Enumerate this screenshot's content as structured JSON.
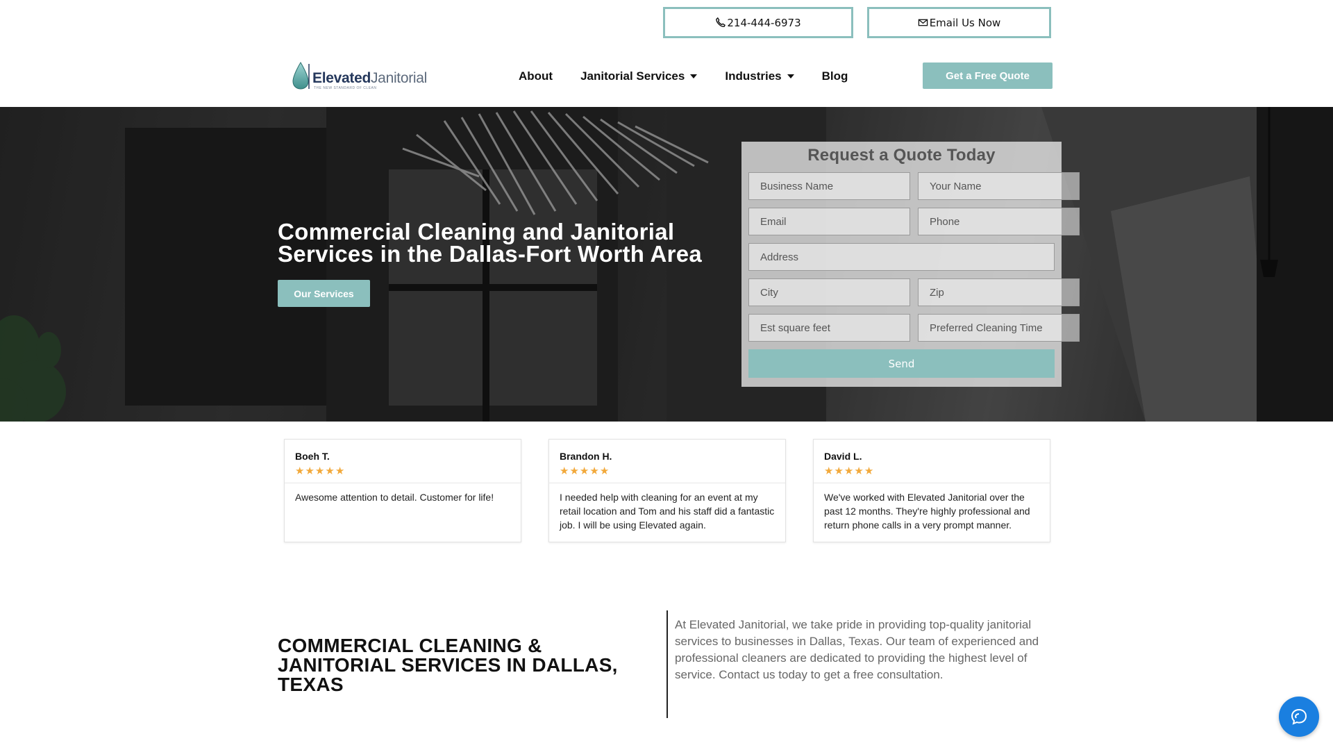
{
  "topbar": {
    "phone_label": "214-444-6973",
    "email_label": "Email Us Now"
  },
  "logo": {
    "word1": "Elevated",
    "word2": "Janitorial",
    "tagline": "THE NEW STANDARD OF CLEAN"
  },
  "nav": {
    "items": [
      {
        "label": "About"
      },
      {
        "label": "Janitorial Services"
      },
      {
        "label": "Industries"
      },
      {
        "label": "Blog"
      }
    ],
    "cta_label": "Get a Free Quote"
  },
  "hero": {
    "title": "Commercial Cleaning and Janitorial Services in the Dallas-Fort Worth Area",
    "button_label": "Our Services"
  },
  "form": {
    "title": "Request a Quote Today",
    "fields": {
      "business_name": "Business Name",
      "your_name": "Your Name",
      "email": "Email",
      "phone": "Phone",
      "address": "Address",
      "city": "City",
      "zip": "Zip",
      "sqft": "Est square feet",
      "time": "Preferred Cleaning Time"
    },
    "send_label": "Send"
  },
  "reviews": [
    {
      "name": "Boeh T.",
      "rating": 5,
      "text": "Awesome attention to detail. Customer for life!"
    },
    {
      "name": "Brandon H.",
      "rating": 5,
      "text": "I needed help with cleaning for an event at my retail location and Tom and his staff did a fantastic job. I will be using Elevated again."
    },
    {
      "name": "David L.",
      "rating": 5,
      "text": "We've worked with Elevated Janitorial over the past 12 months. They're highly professional and return phone calls in a very prompt manner."
    }
  ],
  "about": {
    "title": "COMMERCIAL CLEANING & JANITORIAL SERVICES IN DALLAS, TEXAS",
    "text": "At Elevated Janitorial, we take pride in providing top-quality janitorial services to businesses in Dallas, Texas. Our team of experienced and professional cleaners are dedicated to providing the highest level of service.  Contact us today to get a free consultation."
  },
  "colors": {
    "accent": "#8bbfbd",
    "chat": "#1a7fe0",
    "star": "#f2a93b"
  },
  "icons": {
    "phone": "phone-icon",
    "email": "envelope-icon",
    "chat": "chat-icon",
    "star": "star-icon",
    "logo": "water-drop-icon"
  }
}
